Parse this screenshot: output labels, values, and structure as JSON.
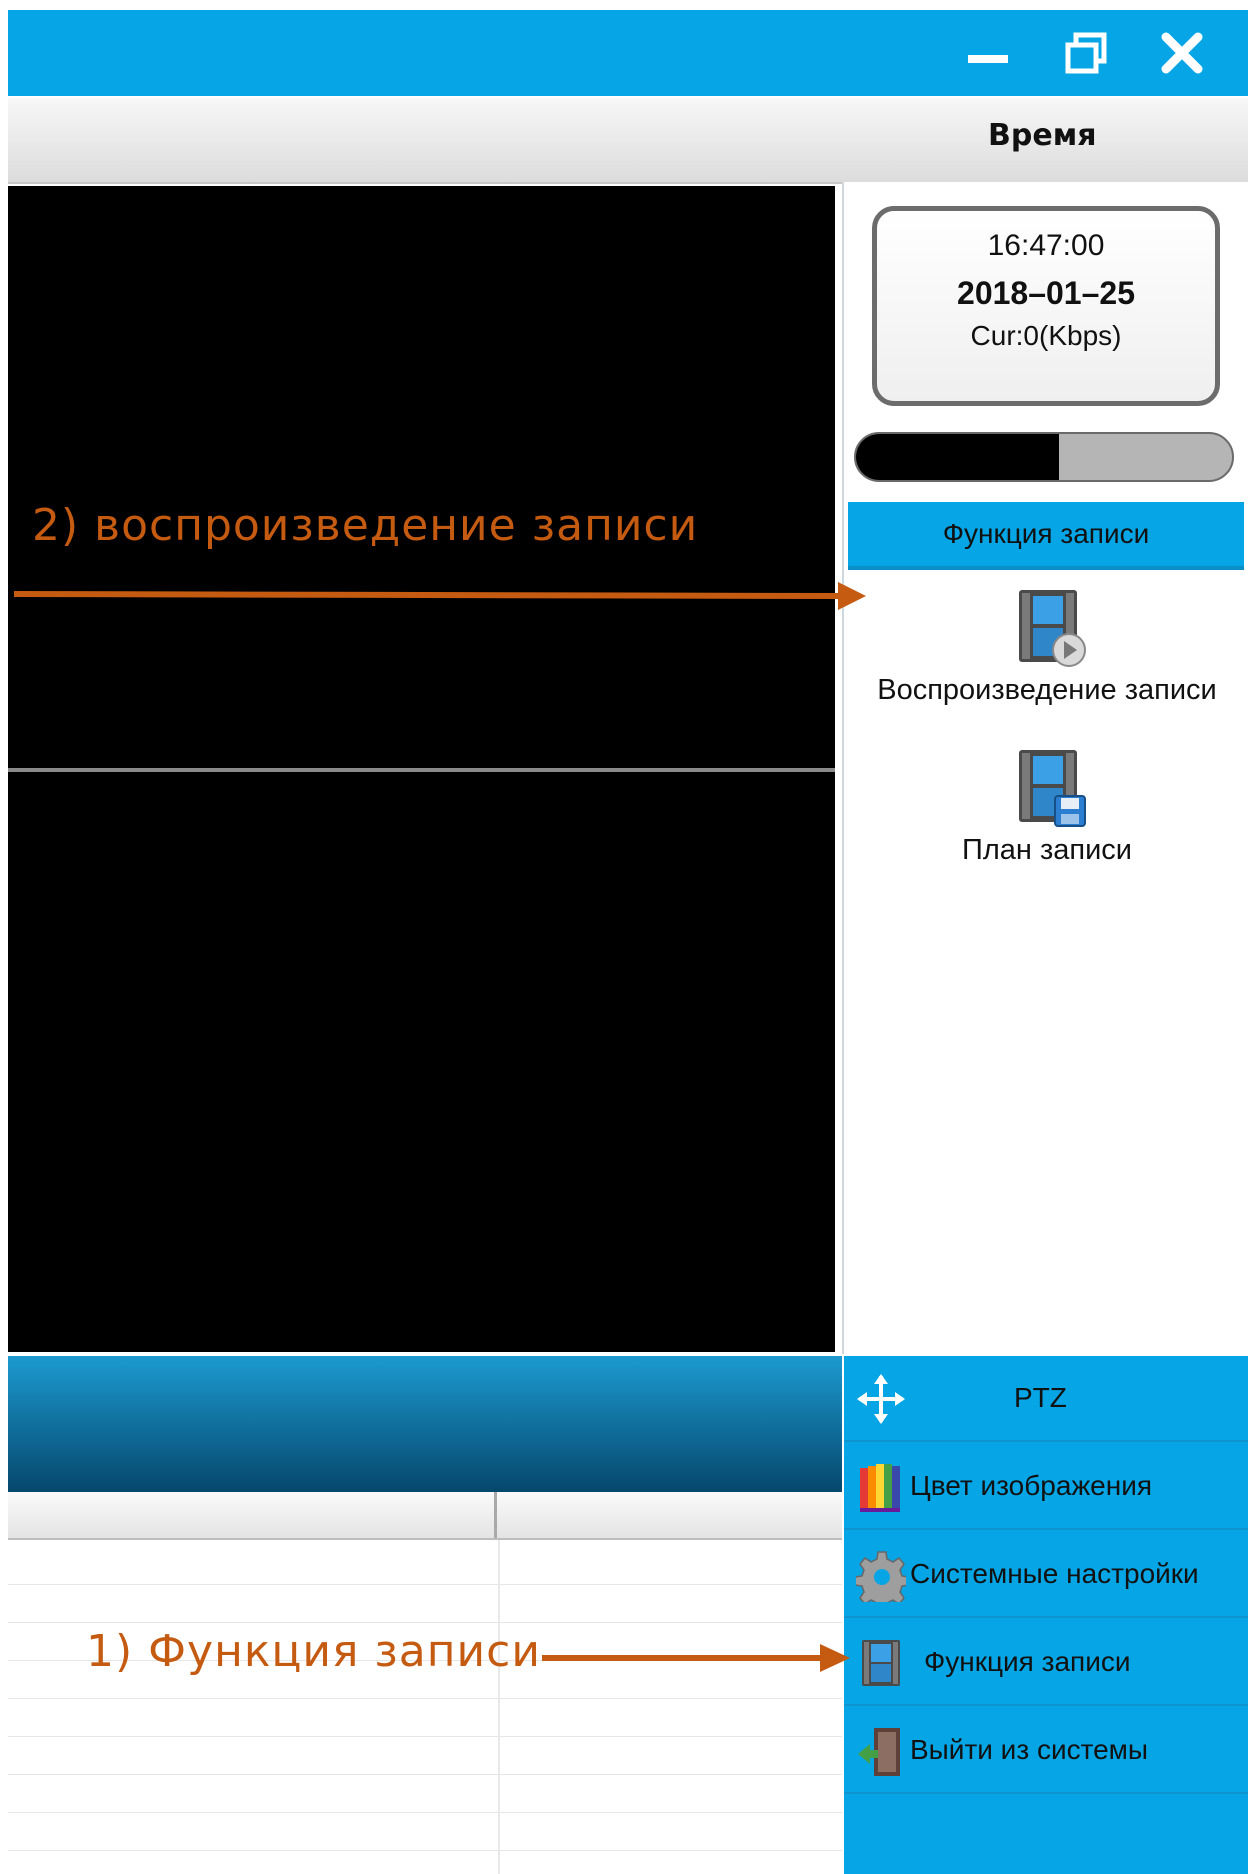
{
  "window": {
    "title": ""
  },
  "header": {
    "time_label": "Время"
  },
  "status": {
    "time": "16:47:00",
    "date": "2018–01–25",
    "bitrate": "Cur:0(Kbps)",
    "progress_fraction": 0.54
  },
  "record_panel": {
    "title": "Функция записи",
    "items": [
      {
        "label": "Воспроизведение записи",
        "icon": "film-play-icon"
      },
      {
        "label": "План записи",
        "icon": "film-save-icon"
      }
    ]
  },
  "menu": {
    "items": [
      {
        "label": "PTZ",
        "icon": "move-arrows-icon"
      },
      {
        "label": "Цвет изображения",
        "icon": "color-bars-icon"
      },
      {
        "label": "Системные настройки",
        "icon": "gear-icon"
      },
      {
        "label": "Функция записи",
        "icon": "film-icon"
      },
      {
        "label": "Выйти из системы",
        "icon": "exit-door-icon"
      }
    ]
  },
  "annotations": {
    "step1": "1) Функция записи",
    "step2": "2) воспроизведение записи"
  },
  "colors": {
    "accent": "#06a5e5",
    "annotation": "#c55a11"
  }
}
